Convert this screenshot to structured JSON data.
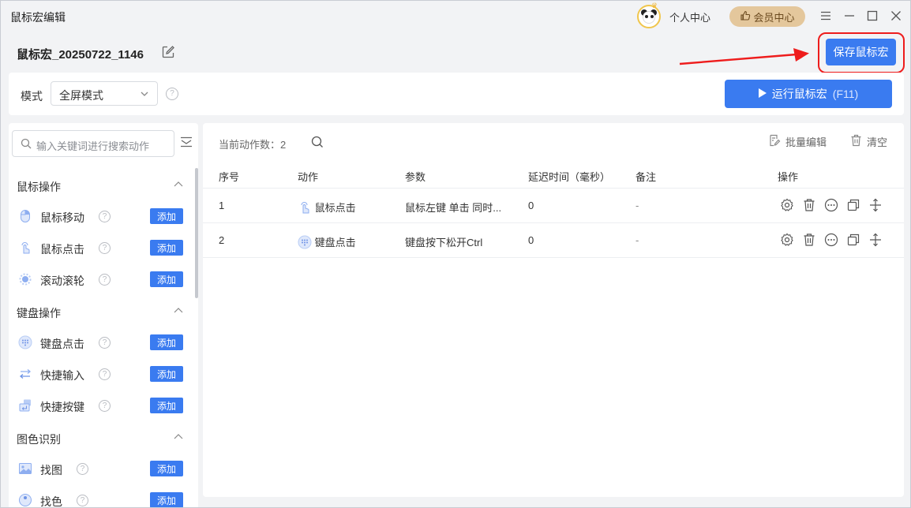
{
  "window": {
    "title": "鼠标宏编辑"
  },
  "header": {
    "personal_center": "个人中心",
    "vip_center": "会员中心"
  },
  "macro": {
    "name": "鼠标宏_20250722_1146",
    "save_label": "保存鼠标宏"
  },
  "mode": {
    "label": "模式",
    "value": "全屏模式",
    "run_label": "运行鼠标宏",
    "run_shortcut": "(F11)"
  },
  "sidebar": {
    "search_placeholder": "输入关键词进行搜索动作",
    "groups": [
      {
        "title": "鼠标操作",
        "items": [
          {
            "label": "鼠标移动",
            "icon": "mouse-move-icon",
            "add": "添加"
          },
          {
            "label": "鼠标点击",
            "icon": "mouse-click-icon",
            "add": "添加"
          },
          {
            "label": "滚动滚轮",
            "icon": "scroll-wheel-icon",
            "add": "添加"
          }
        ]
      },
      {
        "title": "键盘操作",
        "items": [
          {
            "label": "键盘点击",
            "icon": "keyboard-icon",
            "add": "添加"
          },
          {
            "label": "快捷输入",
            "icon": "quick-input-icon",
            "add": "添加"
          },
          {
            "label": "快捷按键",
            "icon": "hotkey-icon",
            "add": "添加"
          }
        ]
      },
      {
        "title": "图色识别",
        "items": [
          {
            "label": "找图",
            "icon": "find-image-icon",
            "add": "添加"
          },
          {
            "label": "找色",
            "icon": "find-color-icon",
            "add": "添加"
          }
        ]
      }
    ]
  },
  "main": {
    "count_label": "当前动作数：2",
    "batch_edit": "批量编辑",
    "clear": "清空",
    "columns": [
      "序号",
      "动作",
      "参数",
      "延迟时间（毫秒）",
      "备注",
      "操作"
    ],
    "rows": [
      {
        "index": "1",
        "action": "鼠标点击",
        "icon": "mouse-click-icon",
        "params": "鼠标左键 单击 同时...",
        "delay": "0",
        "note": "-"
      },
      {
        "index": "2",
        "action": "键盘点击",
        "icon": "keyboard-icon",
        "params": "键盘按下松开Ctrl",
        "delay": "0",
        "note": "-"
      }
    ]
  },
  "colors": {
    "accent": "#3a7bf0",
    "vip": "#e4c79c",
    "highlight": "#ee1c1c"
  }
}
